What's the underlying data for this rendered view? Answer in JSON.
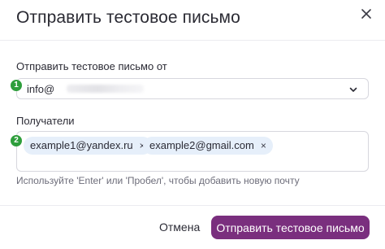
{
  "dialog": {
    "title": "Отправить тестовое письмо",
    "close_icon": "close-icon"
  },
  "sender": {
    "label": "Отправить тестовое письмо от",
    "value": "info@",
    "step_badge": "1",
    "chevron_icon": "chevron-down-icon"
  },
  "recipients": {
    "label": "Получатели",
    "step_badge": "2",
    "tags": [
      {
        "email": "example1@yandex.ru",
        "remove_glyph": "×"
      },
      {
        "email": "example2@gmail.com",
        "remove_glyph": "×"
      }
    ],
    "hint": "Используйте 'Enter' или 'Пробел', чтобы добавить новую почту"
  },
  "footer": {
    "cancel_label": "Отмена",
    "submit_label": "Отправить тестовое письмо"
  },
  "colors": {
    "primary": "#7a2f7e",
    "badge": "#2e9e3c",
    "tag_bg": "#e6effa",
    "border": "#d7d7de"
  }
}
